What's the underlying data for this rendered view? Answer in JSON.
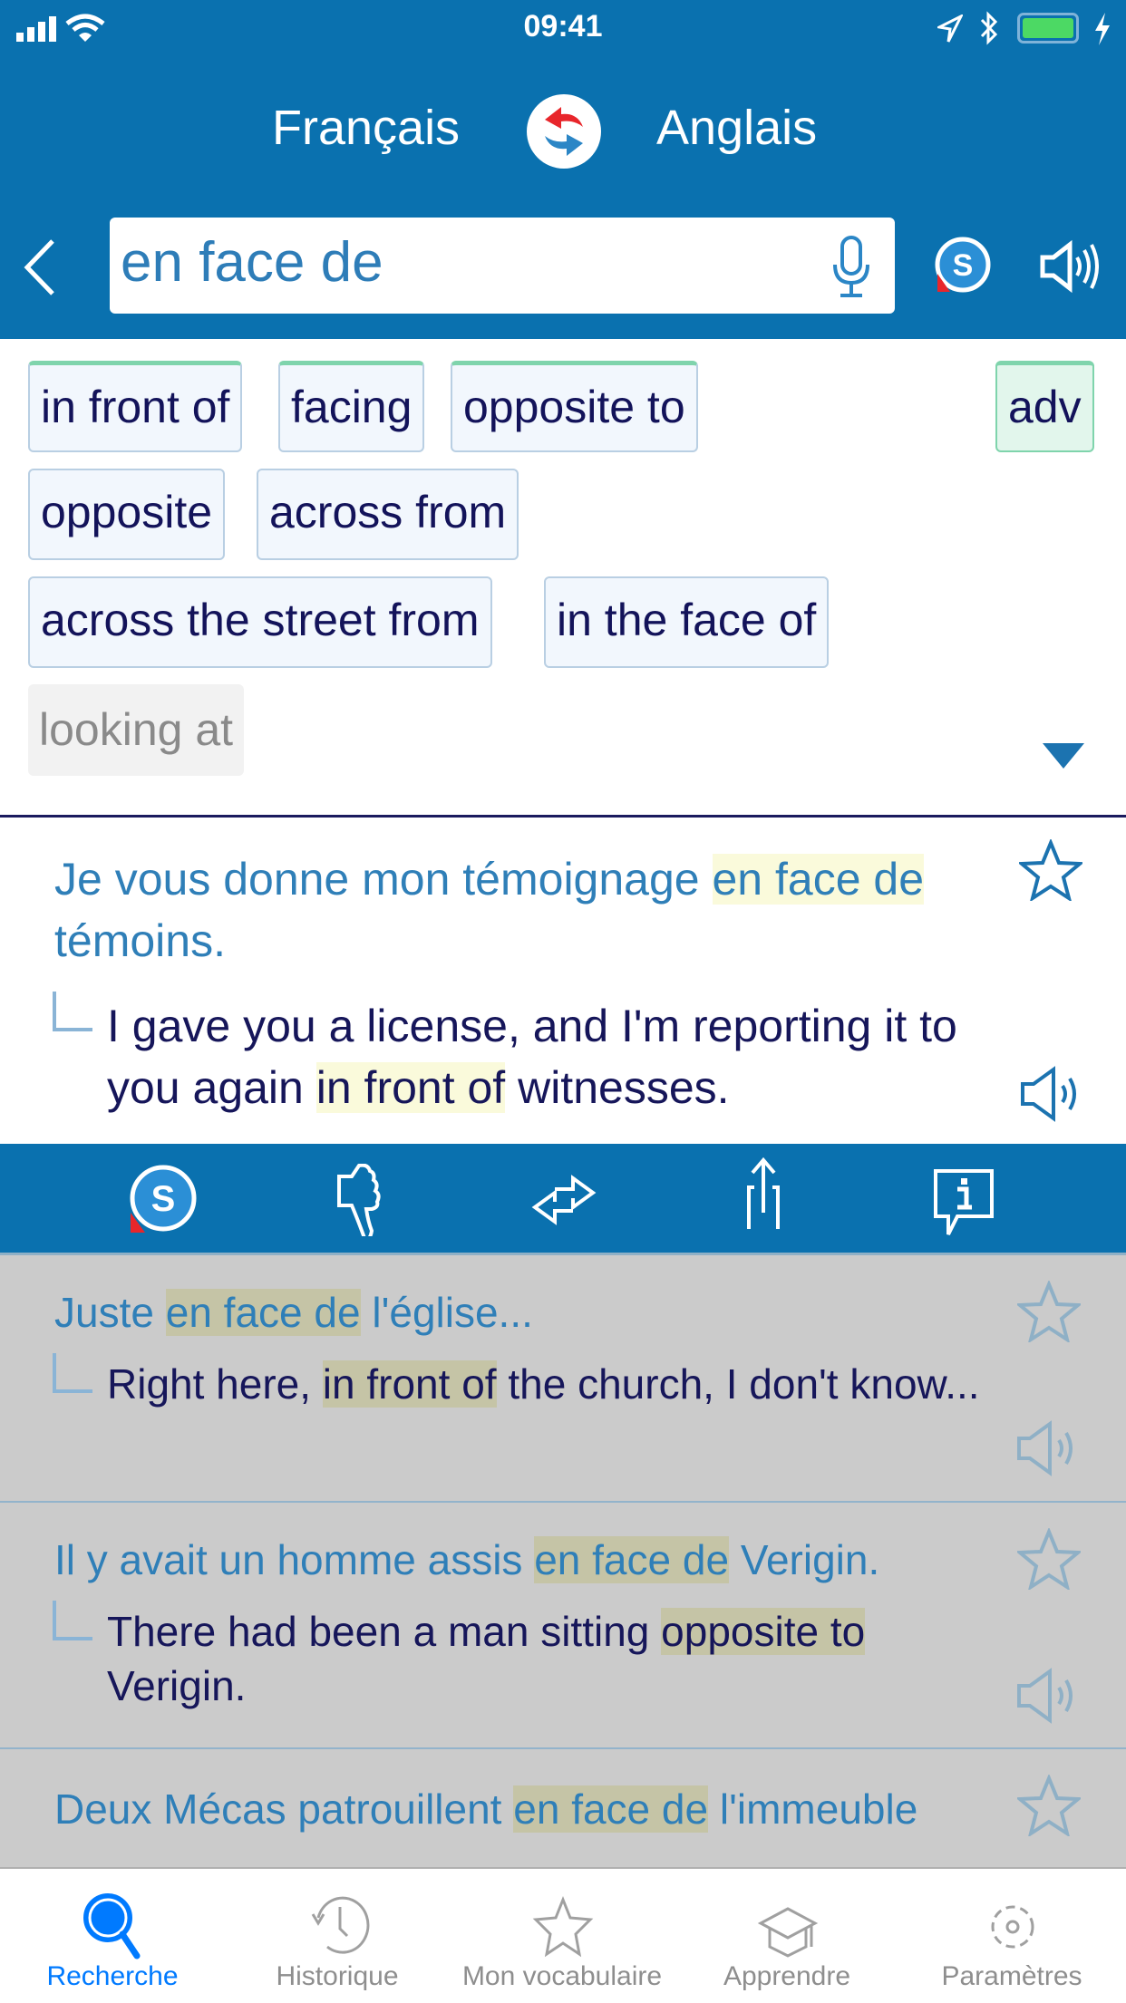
{
  "status": {
    "time": "09:41"
  },
  "header": {
    "source_lang": "Français",
    "target_lang": "Anglais",
    "search_value": "en face de"
  },
  "chips": [
    {
      "label": "in front of"
    },
    {
      "label": "facing"
    },
    {
      "label": "opposite to"
    },
    {
      "label": "adv"
    },
    {
      "label": "opposite"
    },
    {
      "label": "across from"
    },
    {
      "label": "across the street from"
    },
    {
      "label": "in the face of"
    },
    {
      "label": "looking at"
    }
  ],
  "example": {
    "fr_before": "Je vous donne mon témoignage ",
    "fr_hl": "en face de",
    "fr_after": " témoins.",
    "en_before": "I gave you a license, and I'm reporting it to you again ",
    "en_hl": "in front of",
    "en_after": " witnesses."
  },
  "list": [
    {
      "fr_before": "Juste ",
      "fr_hl": "en face de",
      "fr_after": " l'église...",
      "en_before": "Right here, ",
      "en_hl": "in front of",
      "en_after": " the church, I don't know..."
    },
    {
      "fr_before": "Il y avait un homme assis ",
      "fr_hl": "en face de",
      "fr_after": " Verigin.",
      "en_before": "There had been a man sitting ",
      "en_hl": "opposite to",
      "en_after": " Verigin."
    },
    {
      "fr_before": "Deux Mécas patrouillent ",
      "fr_hl": "en face de",
      "fr_after": " l'immeuble",
      "en_before": "",
      "en_hl": "",
      "en_after": ""
    }
  ],
  "tabs": [
    {
      "label": "Recherche",
      "icon": "search-icon"
    },
    {
      "label": "Historique",
      "icon": "history-icon"
    },
    {
      "label": "Mon vocabulaire",
      "icon": "star-icon"
    },
    {
      "label": "Apprendre",
      "icon": "graduation-cap-icon"
    },
    {
      "label": "Paramètres",
      "icon": "gear-icon"
    }
  ],
  "colors": {
    "brand": "#0a71af",
    "active_tab": "#007aff",
    "highlight": "#fafadb",
    "battery": "#4cd964"
  }
}
